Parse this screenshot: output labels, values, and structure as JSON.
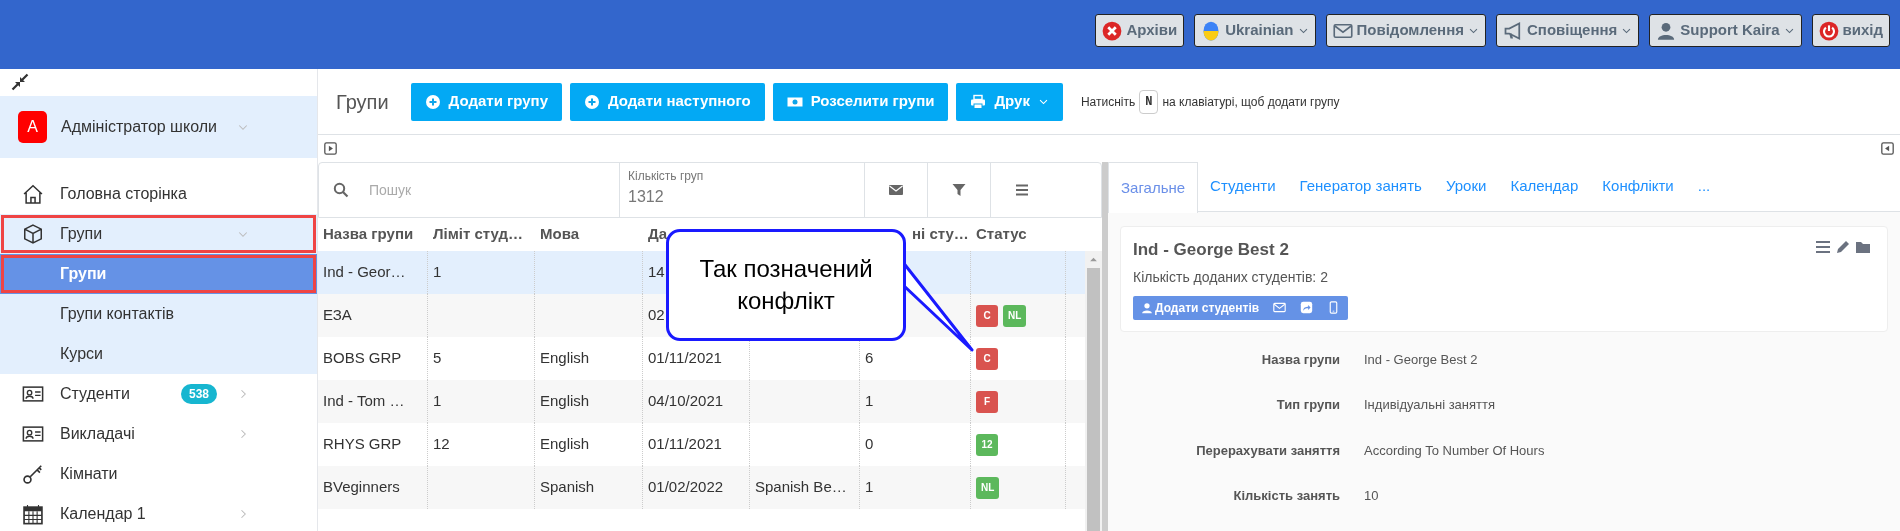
{
  "top_bar": {
    "buttons": [
      {
        "label": "Архіви",
        "dropdown": false
      },
      {
        "label": "Ukrainian",
        "dropdown": true
      },
      {
        "label": "Повідомлення",
        "dropdown": true
      },
      {
        "label": "Сповіщення",
        "dropdown": true
      },
      {
        "label": "Support Kaira",
        "dropdown": true
      },
      {
        "label": "вихід",
        "dropdown": false
      }
    ]
  },
  "sidebar": {
    "account": {
      "initial": "А",
      "name": "Адміністратор школи",
      "expanded": false
    },
    "items": [
      {
        "label": "Головна сторінка",
        "selected": false,
        "highlighted": false
      },
      {
        "label": "Групи",
        "selected": false,
        "highlighted": true,
        "expanded": true,
        "children": [
          {
            "label": "Групи",
            "selected": true,
            "highlighted": true
          },
          {
            "label": "Групи контактів",
            "selected": false,
            "highlighted": false
          },
          {
            "label": "Курси",
            "selected": false,
            "highlighted": false
          }
        ]
      },
      {
        "label": "Студенти",
        "selected": false,
        "highlighted": false,
        "expanded": false,
        "badge": "538"
      },
      {
        "label": "Викладачі",
        "selected": false,
        "highlighted": false,
        "expanded": false
      },
      {
        "label": "Кімнати",
        "selected": false,
        "highlighted": false
      },
      {
        "label": "Календар 1",
        "selected": false,
        "highlighted": false,
        "expanded": false
      }
    ]
  },
  "toolbar": {
    "title": "Групи",
    "buttons": [
      {
        "label": "Додати групу",
        "dropdown": false
      },
      {
        "label": "Додати наступного",
        "dropdown": false
      },
      {
        "label": "Розселити групи",
        "dropdown": false
      },
      {
        "label": "Друк",
        "dropdown": true
      }
    ],
    "hint_before": "Натисніть",
    "hint_key": "N",
    "hint_after": "на клавіатурі, щоб додати групу"
  },
  "groups_table": {
    "search": {
      "placeholder": "Пошук"
    },
    "count_label": "Кількість груп",
    "count": "1312",
    "columns": [
      "Назва групи",
      "Ліміт студ…",
      "Мова",
      "Да",
      "",
      "ні сту…",
      "Статус"
    ],
    "rows": [
      {
        "selected": true,
        "cells": [
          "Ind - Geor…",
          "1",
          "",
          "14",
          "",
          "",
          ""
        ],
        "status": []
      },
      {
        "selected": false,
        "cells": [
          "ЕЗА",
          "",
          "",
          "02",
          "",
          "",
          ""
        ],
        "status": [
          {
            "text": "C",
            "color": "#d9534f"
          },
          {
            "text": "NL",
            "color": "#5cb85c"
          }
        ]
      },
      {
        "selected": false,
        "cells": [
          "BOBS GRP",
          "5",
          "English",
          "01/11/2021",
          "",
          "6",
          ""
        ],
        "status": [
          {
            "text": "C",
            "color": "#d9534f"
          }
        ]
      },
      {
        "selected": false,
        "cells": [
          "Ind - Tom …",
          "1",
          "English",
          "04/10/2021",
          "",
          "1",
          ""
        ],
        "status": [
          {
            "text": "F",
            "color": "#d9534f"
          }
        ]
      },
      {
        "selected": false,
        "cells": [
          "RHYS GRP",
          "12",
          "English",
          "01/11/2021",
          "",
          "0",
          ""
        ],
        "status": [
          {
            "text": "12",
            "color": "#5cb85c"
          }
        ]
      },
      {
        "selected": false,
        "cells": [
          "BVeginners",
          "",
          "Spanish",
          "01/02/2022",
          "Spanish Be…",
          "1",
          ""
        ],
        "status": [
          {
            "text": "NL",
            "color": "#5cb85c"
          }
        ]
      }
    ],
    "callout": {
      "text": "Так позначений конфлікт"
    }
  },
  "details": {
    "tabs": [
      {
        "label": "Загальне",
        "selected": true
      },
      {
        "label": "Студенти",
        "selected": false
      },
      {
        "label": "Генератор занять",
        "selected": false
      },
      {
        "label": "Уроки",
        "selected": false
      },
      {
        "label": "Календар",
        "selected": false
      },
      {
        "label": "Конфлікти",
        "selected": false
      },
      {
        "label": "...",
        "selected": false
      }
    ],
    "card": {
      "title": "Ind - George Best 2",
      "subtitle": "Кількість доданих студентів: 2",
      "add_button": "Додати студентів"
    },
    "fields": [
      {
        "label": "Назва групи",
        "value": "Ind - George Best 2"
      },
      {
        "label": "Тип групи",
        "value": "Індивідуальні заняття"
      },
      {
        "label": "Перерахувати заняття",
        "value": "According To Number Of Hours"
      },
      {
        "label": "Кількість занять",
        "value": "10"
      }
    ]
  }
}
